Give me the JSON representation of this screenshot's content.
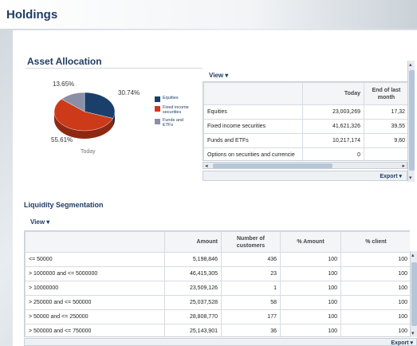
{
  "page": {
    "title": "Holdings"
  },
  "asset_allocation": {
    "title": "Asset Allocation",
    "pie": {
      "slices": [
        {
          "name": "Equities",
          "pct": 30.74,
          "label": "30.74%",
          "color": "#1b3f6b"
        },
        {
          "name": "Fixed income securities",
          "pct": 55.61,
          "label": "55.61%",
          "color": "#cc3a1a"
        },
        {
          "name": "Funds and ETFs",
          "pct": 13.65,
          "label": "13.65%",
          "color": "#8a8fa6"
        }
      ],
      "caption": "Today"
    },
    "legend": [
      "Equities",
      "Fixed income securities",
      "Funds and ETFs"
    ],
    "view_label": "View ▾",
    "export_label": "Export ▾",
    "columns": [
      "",
      "Today",
      "End of last month"
    ],
    "rows": [
      {
        "name": "Equities",
        "today": "23,003,269",
        "last": "17,32"
      },
      {
        "name": "Fixed income securities",
        "today": "41,621,326",
        "last": "39,55"
      },
      {
        "name": "Funds and ETFs",
        "today": "10,217,174",
        "last": "9,60"
      },
      {
        "name": "Options on securities and currencie",
        "today": "0",
        "last": ""
      }
    ]
  },
  "liquidity": {
    "title": "Liquidity Segmentation",
    "view_label": "View ▾",
    "export_label": "Export ▾",
    "columns": [
      "",
      "Amount",
      "Number of customers",
      "% Amount",
      "% client"
    ],
    "rows": [
      {
        "range": "<= 50000",
        "amount": "5,198,846",
        "customers": "436",
        "pct_amount": "100",
        "pct_client": "100"
      },
      {
        "range": "> 1000000 and <= 5000000",
        "amount": "46,415,305",
        "customers": "23",
        "pct_amount": "100",
        "pct_client": "100"
      },
      {
        "range": "> 10000000",
        "amount": "23,509,126",
        "customers": "1",
        "pct_amount": "100",
        "pct_client": "100"
      },
      {
        "range": "> 250000 and <= 500000",
        "amount": "25,037,528",
        "customers": "58",
        "pct_amount": "100",
        "pct_client": "100"
      },
      {
        "range": "> 50000 and <= 250000",
        "amount": "28,808,770",
        "customers": "177",
        "pct_amount": "100",
        "pct_client": "100"
      },
      {
        "range": "> 500000 and <= 750000",
        "amount": "25,143,901",
        "customers": "36",
        "pct_amount": "100",
        "pct_client": "100"
      }
    ]
  }
}
